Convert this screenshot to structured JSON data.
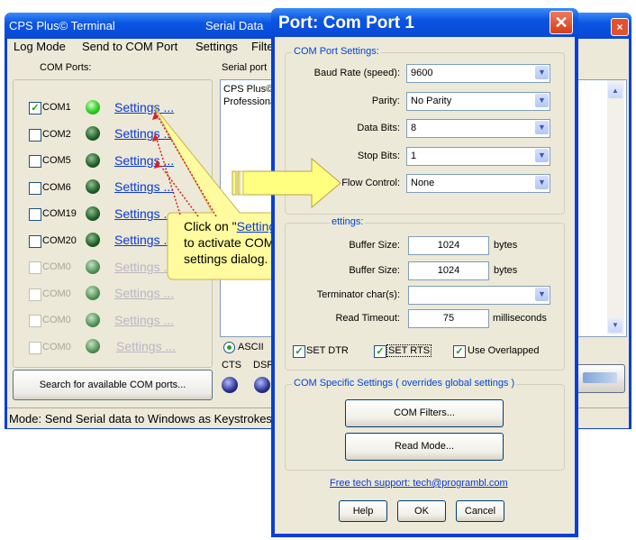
{
  "background_window": {
    "title": "CPS Plus© Terminal",
    "title_right": "Serial Data",
    "menu": [
      "Log Mode",
      "Send to COM Port",
      "Settings",
      "Filte"
    ],
    "com_ports_label": "COM Ports:",
    "com_ports": [
      {
        "name": "COM1",
        "checked": true,
        "enabled": true,
        "led": "on",
        "link": "Settings ..."
      },
      {
        "name": "COM2",
        "checked": false,
        "enabled": true,
        "led": "off",
        "link": "Settings ..."
      },
      {
        "name": "COM5",
        "checked": false,
        "enabled": true,
        "led": "off",
        "link": "Settings ..."
      },
      {
        "name": "COM6",
        "checked": false,
        "enabled": true,
        "led": "off",
        "link": "Settings ..."
      },
      {
        "name": "COM19",
        "checked": false,
        "enabled": true,
        "led": "off",
        "link": "Settings ..."
      },
      {
        "name": "COM20",
        "checked": false,
        "enabled": true,
        "led": "off",
        "link": "Settings ..."
      },
      {
        "name": "COM0",
        "checked": false,
        "enabled": false,
        "led": "dim",
        "link": "Settings ..."
      },
      {
        "name": "COM0",
        "checked": false,
        "enabled": false,
        "led": "dim",
        "link": "Settings ..."
      },
      {
        "name": "COM0",
        "checked": false,
        "enabled": false,
        "led": "dim",
        "link": "Settings ..."
      },
      {
        "name": "COM0",
        "checked": false,
        "enabled": false,
        "led": "dim",
        "link": "Settings ..."
      }
    ],
    "search_button": "Search for available COM ports...",
    "serial_port_label": "Serial port",
    "serial_text": [
      "CPS Plus©",
      "Professiona"
    ],
    "ascii_label": "ASCII",
    "cts_label": "CTS",
    "dsr_label": "DSR",
    "status": "Mode: Send Serial data to Windows as Keystrokes"
  },
  "callout": {
    "prefix": "Click on \"",
    "link": "Settings...",
    "suffix": "\"",
    "rest": "to activate COM port settings dialog."
  },
  "dialog": {
    "title": "Port: Com Port 1",
    "close_icon": "close-icon",
    "com_port_settings": {
      "group_title": "COM Port Settings:",
      "baud_rate": {
        "label": "Baud Rate (speed):",
        "value": "9600"
      },
      "parity": {
        "label": "Parity:",
        "value": "No Parity"
      },
      "data_bits": {
        "label": "Data Bits:",
        "value": "8"
      },
      "stop_bits": {
        "label": "Stop Bits:",
        "value": "1"
      },
      "flow_control": {
        "label": "Flow Control:",
        "value": "None"
      }
    },
    "other_settings": {
      "group_title": "ettings:",
      "input_buffer": {
        "label": "Buffer Size:",
        "value": "1024",
        "units": "bytes"
      },
      "output_buffer": {
        "label": "Buffer Size:",
        "value": "1024",
        "units": "bytes"
      },
      "terminator": {
        "label": "Terminator char(s):",
        "value": ""
      },
      "read_timeout": {
        "label": "Read Timeout:",
        "value": "75",
        "units": "milliseconds"
      },
      "set_dtr": {
        "label": "SET DTR",
        "checked": true
      },
      "set_rts": {
        "label": "SET RTS",
        "checked": true
      },
      "use_overlapped": {
        "label": "Use Overlapped",
        "checked": true
      }
    },
    "com_specific": {
      "group_title": "COM Specific Settings ( overrides global settings )",
      "filters_button": "COM Filters...",
      "read_mode_button": "Read Mode..."
    },
    "support_link": "Free tech support: tech@programbl.com",
    "buttons": {
      "help": "Help",
      "ok": "OK",
      "cancel": "Cancel"
    }
  },
  "colors": {
    "xp_title_blue": "#0b55e4",
    "link_blue": "#0b39d8",
    "group_title_blue": "#0046d5",
    "callout_fill": "#fffb9e",
    "arrow_fill": "#ffff80"
  }
}
